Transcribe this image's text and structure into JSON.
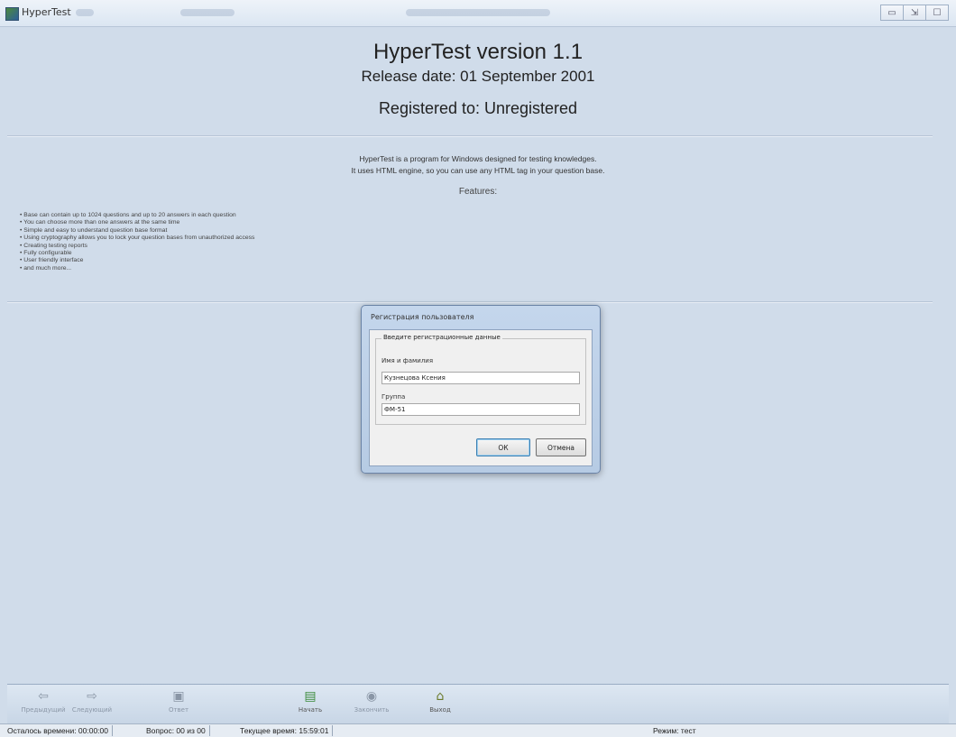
{
  "window": {
    "title": "HyperTest",
    "buttons": [
      "▭",
      "⇲",
      "☐"
    ]
  },
  "header": {
    "title": "HyperTest version 1.1",
    "release": "Release date: 01 September 2001",
    "registered": "Registered to: Unregistered"
  },
  "description": {
    "line1": "HyperTest is a program for Windows designed for testing knowledges.",
    "line2": "It uses HTML engine, so you can use any HTML tag in your question base.",
    "features_title": "Features:"
  },
  "features": [
    "Base can contain up to 1024 questions and up to 20 answers in each question",
    "You can choose more than one answers at the same time",
    "Simple and easy to understand question base format",
    "Using cryptography allows you to lock your question bases from unauthorized access",
    "Creating testing reports",
    "Fully configurable",
    "User friendly interface",
    "and much more..."
  ],
  "dialog": {
    "title": "Регистрация пользователя",
    "group_label": "Введите регистрационные данные",
    "name_label": "Имя и фамилия",
    "name_value": "Кузнецова Ксения",
    "group_field_label": "Группа",
    "group_value": "ФМ-51",
    "ok_label": "ОК",
    "cancel_label": "Отмена"
  },
  "toolbar": {
    "items": [
      {
        "label": "Предыдущий",
        "icon": "arrow-left-icon",
        "glyph": "⇦",
        "enabled": false
      },
      {
        "label": "Следующий",
        "icon": "arrow-right-icon",
        "glyph": "⇨",
        "enabled": false
      },
      {
        "label": "Ответ",
        "icon": "answer-icon",
        "glyph": "▣",
        "enabled": false
      },
      {
        "label": "Начать",
        "icon": "start-icon",
        "glyph": "▤",
        "enabled": true
      },
      {
        "label": "Закончить",
        "icon": "stop-icon",
        "glyph": "◉",
        "enabled": false
      },
      {
        "label": "Выход",
        "icon": "home-icon",
        "glyph": "⌂",
        "enabled": true
      }
    ]
  },
  "statusbar": {
    "remaining": "Осталось времени: 00:00:00",
    "question": "Вопрос: 00 из 00",
    "current_time": "Текущее время: 15:59:01",
    "mode": "Режим: тест"
  }
}
